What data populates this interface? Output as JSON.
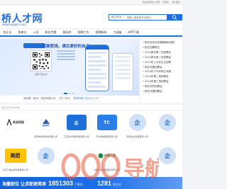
{
  "topbar": {
    "welcome": "欢迎来到桥人才网",
    "links": [
      "手机版",
      "用户服务"
    ]
  },
  "header": {
    "logo_text": "桥人才网",
    "logo_url": "www.uxkqrc.com",
    "search_select": "找工作",
    "search_placeholder": "请输入搜索条件关键字"
  },
  "nav": {
    "items": [
      "找企业",
      "找单位",
      "公司",
      "职位专题",
      "简历库",
      "招聘工作",
      "招聘新闻",
      "工具箱",
      "APP下载"
    ]
  },
  "banner": {
    "slogan": "招新职场，遇见更好的自己",
    "qr_caption": "扫码下载APP",
    "company": "安科顺（南京）科技有限公司",
    "time": "下载了解读",
    "download": "发布时间 2024-11-13"
  },
  "news": {
    "items": [
      "职位年终目标薪酬福利调查",
      "职位招聘职位",
      "2024新年第二场招聘会",
      "2024新年第二场招聘会",
      "2024年上半年企业招聘",
      "职位专题招聘会",
      "2024年下半年职位专题",
      "2024年第二场招聘会",
      "2024年第三场招聘会",
      "职位年终招聘会",
      "职位专题招聘会"
    ]
  },
  "section": {
    "title": "名企 Enterprise"
  },
  "companies": [
    {
      "name": "实业科技",
      "caption": "",
      "icon": "company-logo-1"
    },
    {
      "name": "安科新材",
      "caption": "安科新材料科技有限公司",
      "icon": "company-logo-2"
    },
    {
      "name": "云",
      "caption": "江苏远方智能科技有限公司",
      "icon": "company-logo-3"
    },
    {
      "name": "TC",
      "caption": "苏州科技服务有限公司",
      "icon": "company-logo-4"
    },
    {
      "name": "企",
      "caption": "南通企业管理有限公司",
      "icon": "company-logo-5"
    },
    {
      "name": "企",
      "caption": "",
      "icon": "company-logo-6"
    },
    {
      "name": "美团",
      "caption": "北京三快在线科技有限公司",
      "icon": "company-logo-7"
    },
    {
      "name": "企",
      "caption": "",
      "icon": "company-logo-8"
    },
    {
      "name": "中国人寿",
      "caption": "中国人寿保险股份有限公司",
      "icon": "company-logo-9"
    },
    {
      "name": "企",
      "caption": "",
      "icon": "company-logo-10"
    }
  ],
  "promo": {
    "text": "海量职位 让求职更简单",
    "stat1": "1851303",
    "stat1_unit": "个职位",
    "stat2": "1281",
    "stat2_unit": "家企业"
  },
  "watermark": {
    "text": "000 导航"
  },
  "colors": {
    "brand": "#1e6fd9",
    "meituan": "#ffc300",
    "nav_bg": "#ffffff"
  }
}
